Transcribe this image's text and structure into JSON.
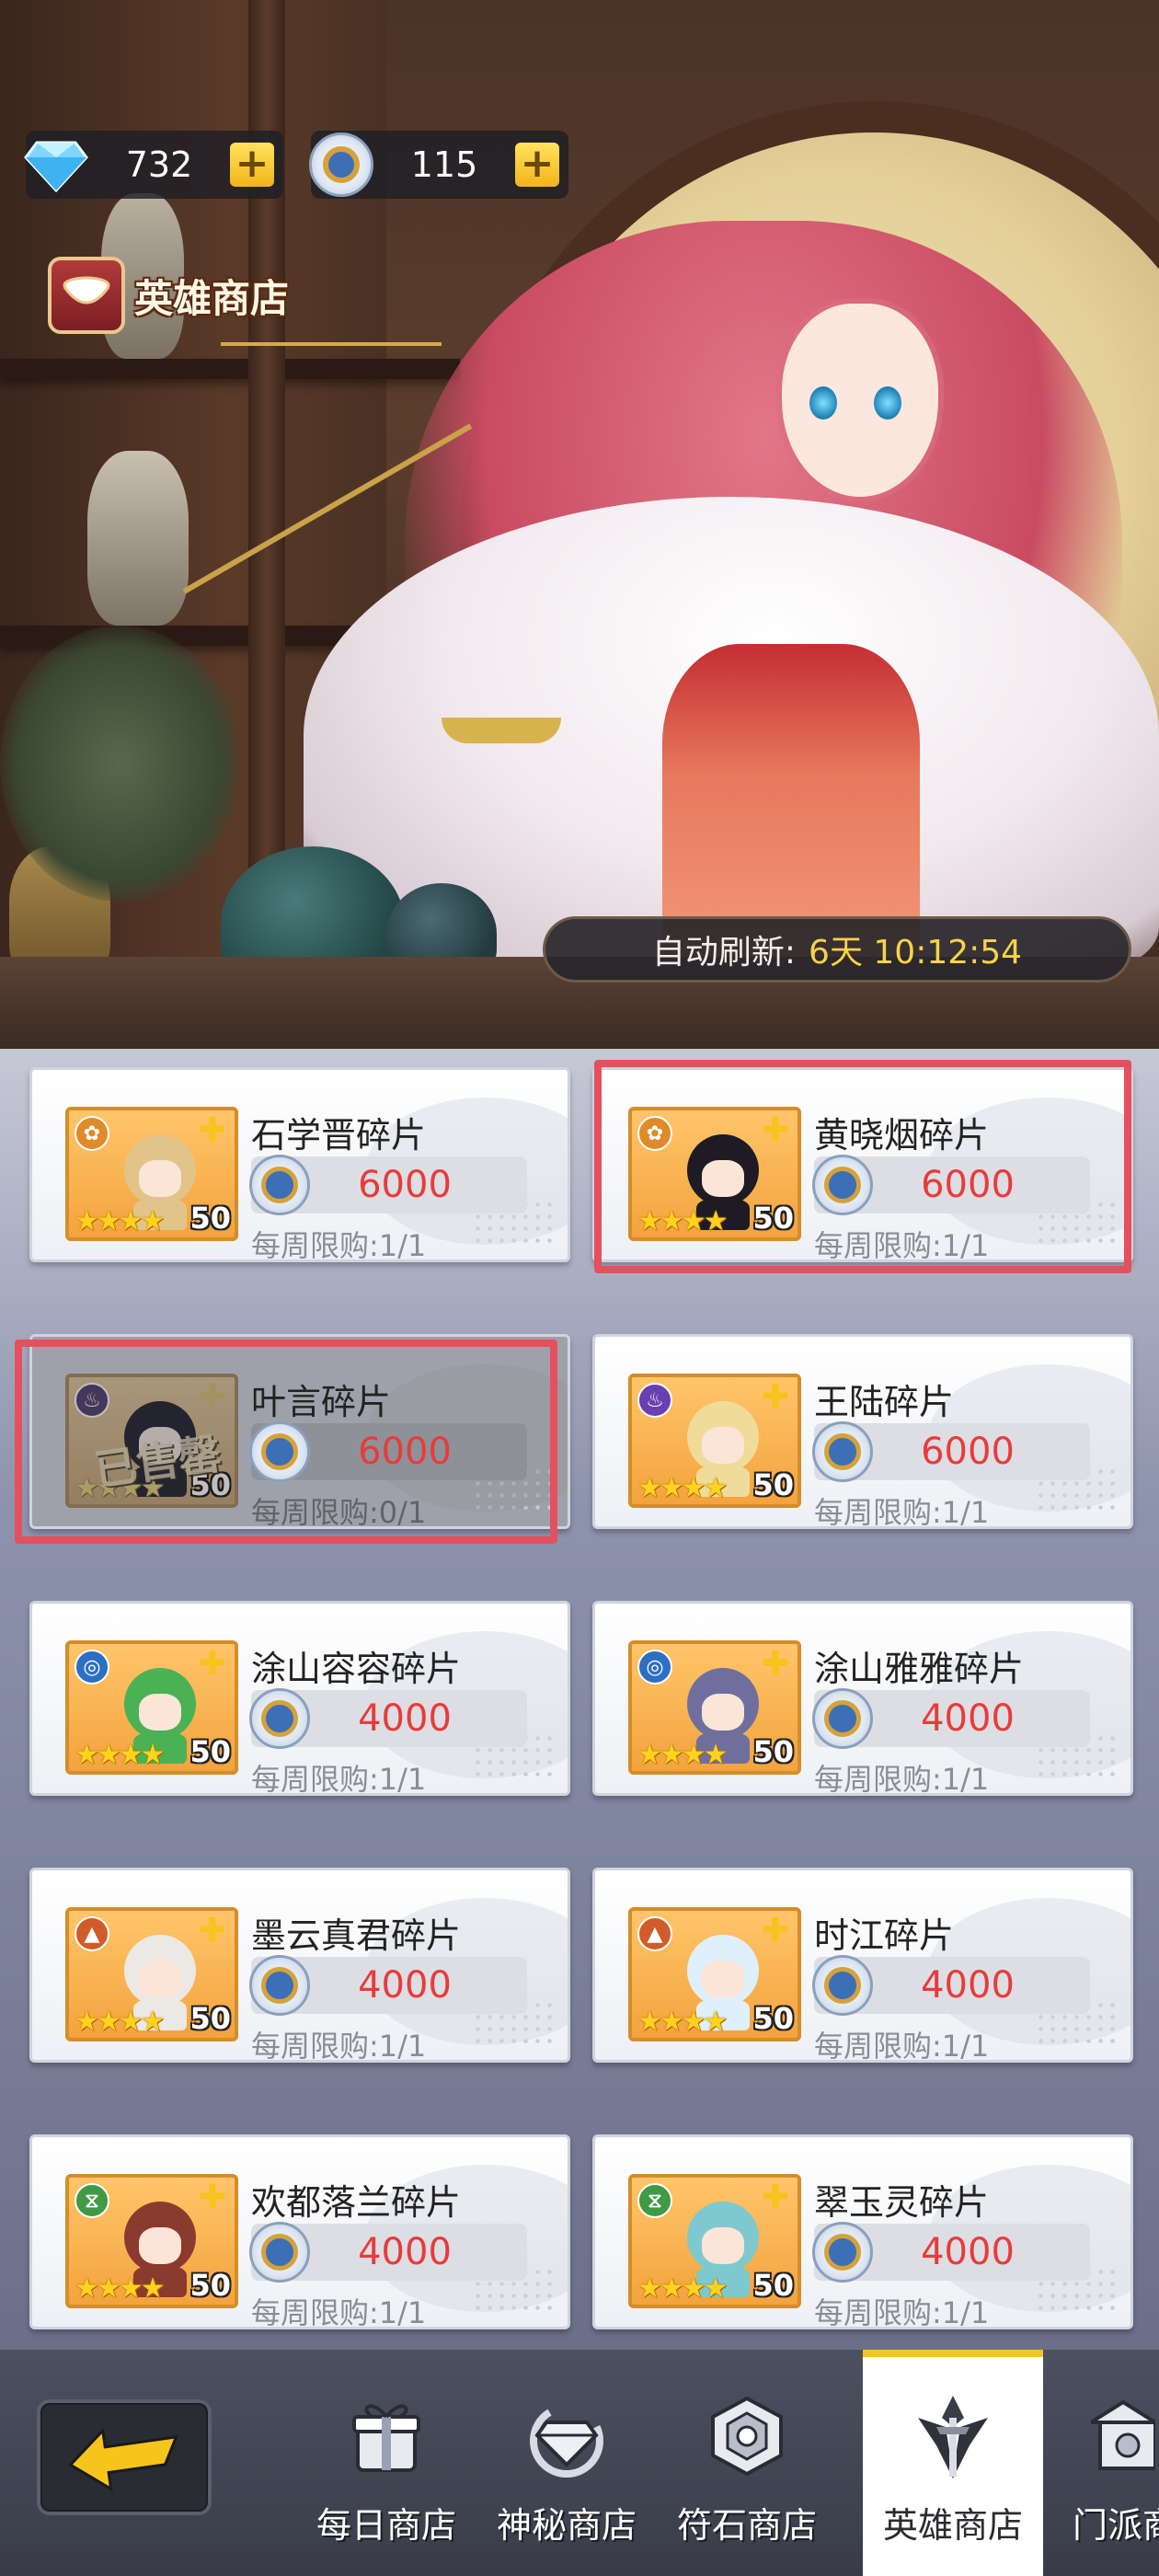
{
  "currencies": [
    {
      "name": "diamond",
      "value": "732",
      "plus": "+"
    },
    {
      "name": "hero-coin",
      "value": "115",
      "plus": "+"
    }
  ],
  "shop_title": "英雄商店",
  "refresh": {
    "label": "自动刷新:",
    "time": "6天 10:12:54"
  },
  "items": [
    {
      "name": "石学晋碎片",
      "price": "6000",
      "limit": "每周限购:1/1",
      "level": "50",
      "faction": "lotus",
      "faction_color": "#e08a2a",
      "hair": "#e2c48a",
      "sold": false
    },
    {
      "name": "黄晓烟碎片",
      "price": "6000",
      "limit": "每周限购:1/1",
      "level": "50",
      "faction": "lotus",
      "faction_color": "#e08a2a",
      "hair": "#1e1b25",
      "sold": false
    },
    {
      "name": "叶言碎片",
      "price": "6000",
      "limit": "每周限购:0/1",
      "level": "50",
      "faction": "flame",
      "faction_color": "#6a3fb0",
      "hair": "#2a2f55",
      "sold": true,
      "sold_text": "已售罄"
    },
    {
      "name": "王陆碎片",
      "price": "6000",
      "limit": "每周限购:1/1",
      "level": "50",
      "faction": "flame",
      "faction_color": "#6a3fb0",
      "hair": "#f0dc9a",
      "sold": false
    },
    {
      "name": "涂山容容碎片",
      "price": "4000",
      "limit": "每周限购:1/1",
      "level": "50",
      "faction": "swirl",
      "faction_color": "#2d6fc2",
      "hair": "#4bb155",
      "sold": false
    },
    {
      "name": "涂山雅雅碎片",
      "price": "4000",
      "limit": "每周限购:1/1",
      "level": "50",
      "faction": "swirl",
      "faction_color": "#2d6fc2",
      "hair": "#6f6f9e",
      "sold": false
    },
    {
      "name": "墨云真君碎片",
      "price": "4000",
      "limit": "每周限购:1/1",
      "level": "50",
      "faction": "mountain",
      "faction_color": "#d15b2a",
      "hair": "#ece8e4",
      "sold": false
    },
    {
      "name": "时江碎片",
      "price": "4000",
      "limit": "每周限购:1/1",
      "level": "50",
      "faction": "mountain",
      "faction_color": "#d15b2a",
      "hair": "#dff0fa",
      "sold": false
    },
    {
      "name": "欢都落兰碎片",
      "price": "4000",
      "limit": "每周限购:1/1",
      "level": "50",
      "faction": "hourglass",
      "faction_color": "#3f9a45",
      "hair": "#8b3a2e",
      "sold": false
    },
    {
      "name": "翠玉灵碎片",
      "price": "4000",
      "limit": "每周限购:1/1",
      "level": "50",
      "faction": "hourglass",
      "faction_color": "#3f9a45",
      "hair": "#7ec9cf",
      "sold": false
    }
  ],
  "stars": "★★★★",
  "nav": {
    "tabs": [
      {
        "label": "每日商店",
        "icon": "gift-icon"
      },
      {
        "label": "神秘商店",
        "icon": "diamond-icon"
      },
      {
        "label": "符石商店",
        "icon": "rune-icon"
      },
      {
        "label": "英雄商店",
        "icon": "hero-icon",
        "active": true
      },
      {
        "label": "门派商",
        "icon": "pavilion-icon"
      }
    ]
  },
  "colors": {
    "accent": "#f3c32a",
    "price": "#e83b3b",
    "highlight": "#e5505e"
  }
}
